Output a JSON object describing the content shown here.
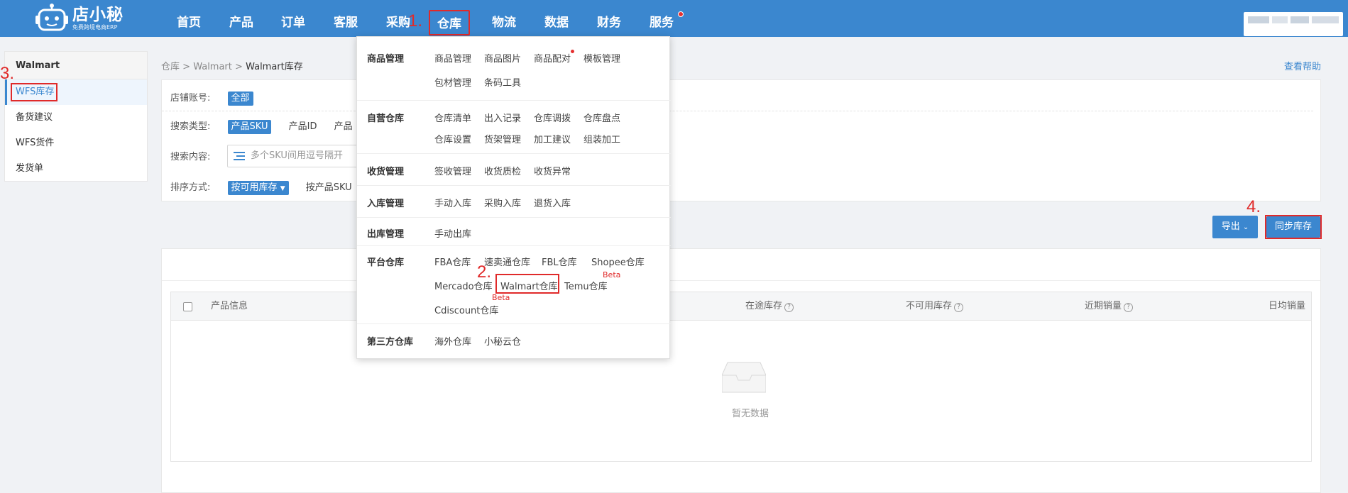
{
  "logo": {
    "title": "店小秘",
    "subtitle": "免费跨境电商ERP"
  },
  "nav": [
    "首页",
    "产品",
    "订单",
    "客服",
    "采购",
    "仓库",
    "物流",
    "数据",
    "财务",
    "服务"
  ],
  "annotations": {
    "a1": "1.",
    "a2": "2.",
    "a3": "3.",
    "a4": "4."
  },
  "sidebar": {
    "header": "Walmart",
    "items": [
      "WFS库存",
      "备货建议",
      "WFS货件",
      "发货单"
    ]
  },
  "breadcrumb": {
    "root": "仓库",
    "sep": ">",
    "mid": "Walmart",
    "current": "Walmart库存"
  },
  "help": "查看帮助",
  "filter": {
    "account_label": "店铺账号:",
    "account_value": "全部",
    "type_label": "搜索类型:",
    "type_selected": "产品SKU",
    "type_options": [
      "产品ID",
      "产品"
    ],
    "content_label": "搜索内容:",
    "content_placeholder": "多个SKU间用逗号隔开",
    "sort_label": "排序方式:",
    "sort_selected": "按可用库存",
    "sort_options": [
      "按产品SKU"
    ]
  },
  "buttons": {
    "export": "导出",
    "sync": "同步库存"
  },
  "table": {
    "columns": [
      "产品信息",
      "在途库存",
      "不可用库存",
      "近期销量",
      "日均销量"
    ],
    "empty": "暂无数据"
  },
  "dropdown": {
    "sections": [
      {
        "title": "商品管理",
        "items": [
          "商品管理",
          "商品图片",
          "商品配对",
          "模板管理",
          "包材管理",
          "条码工具"
        ]
      },
      {
        "title": "自营仓库",
        "items": [
          "仓库清单",
          "出入记录",
          "仓库调拨",
          "仓库盘点",
          "仓库设置",
          "货架管理",
          "加工建议",
          "组装加工"
        ]
      },
      {
        "title": "收货管理",
        "items": [
          "签收管理",
          "收货质检",
          "收货异常"
        ]
      },
      {
        "title": "入库管理",
        "items": [
          "手动入库",
          "采购入库",
          "退货入库"
        ]
      },
      {
        "title": "出库管理",
        "items": [
          "手动出库"
        ]
      },
      {
        "title": "平台仓库",
        "items": [
          "FBA仓库",
          "速卖通仓库",
          "FBL仓库",
          "Shopee仓库",
          "Mercado仓库",
          "Walmart仓库",
          "Temu仓库",
          "Cdiscount仓库"
        ]
      },
      {
        "title": "第三方仓库",
        "items": [
          "海外仓库",
          "小秘云仓"
        ]
      }
    ],
    "beta": "Beta"
  },
  "colors": {
    "primary": "#3b87cf",
    "annotation": "#e02a2a"
  }
}
